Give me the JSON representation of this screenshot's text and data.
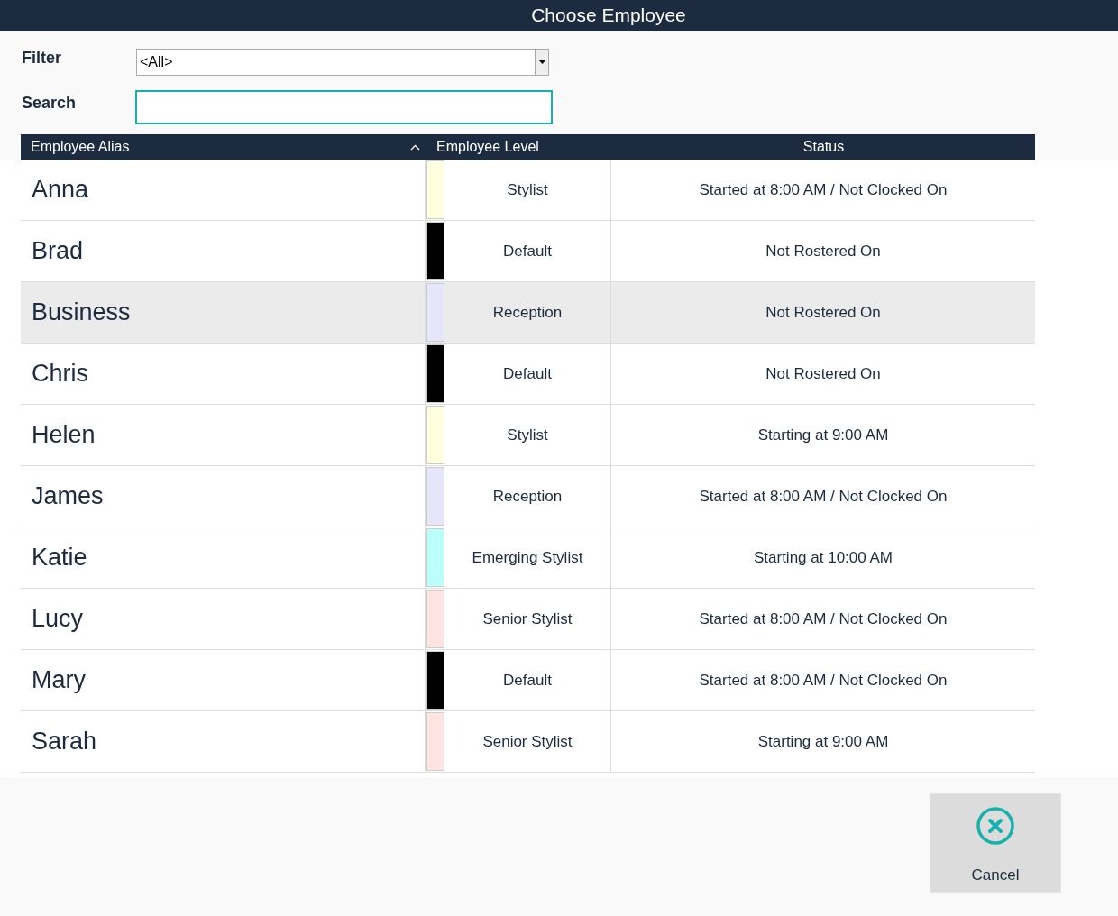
{
  "window": {
    "title": "Choose Employee"
  },
  "filter": {
    "label": "Filter",
    "value": "<All>"
  },
  "search": {
    "label": "Search"
  },
  "table": {
    "columns": [
      {
        "label": "Employee Alias",
        "sorted": true
      },
      {
        "label": "Employee Level",
        "sorted": false
      },
      {
        "label": "Status",
        "sorted": false
      }
    ],
    "rows": [
      {
        "alias": "Anna",
        "level_name": "Stylist",
        "color": "#ffffe0",
        "status": "Started at 8:00 AM / Not Clocked On",
        "selected": false
      },
      {
        "alias": "Brad",
        "level_name": "Default",
        "color": "#000000",
        "status": "Not Rostered On",
        "selected": false
      },
      {
        "alias": "Business",
        "level_name": "Reception",
        "color": "#e6e6fa",
        "status": "Not Rostered On",
        "selected": true
      },
      {
        "alias": "Chris",
        "level_name": "Default",
        "color": "#000000",
        "status": "Not Rostered On",
        "selected": false
      },
      {
        "alias": "Helen",
        "level_name": "Stylist",
        "color": "#ffffe0",
        "status": "Starting at 9:00 AM",
        "selected": false
      },
      {
        "alias": "James",
        "level_name": "Reception",
        "color": "#e6e6fa",
        "status": "Started at 8:00 AM / Not Clocked On",
        "selected": false
      },
      {
        "alias": "Katie",
        "level_name": "Emerging Stylist",
        "color": "#bbfffb",
        "status": "Starting at 10:00 AM",
        "selected": false
      },
      {
        "alias": "Lucy",
        "level_name": "Senior Stylist",
        "color": "#ffe4e1",
        "status": "Started at 8:00 AM / Not Clocked On",
        "selected": false
      },
      {
        "alias": "Mary",
        "level_name": "Default",
        "color": "#000000",
        "status": "Started at 8:00 AM / Not Clocked On",
        "selected": false
      },
      {
        "alias": "Sarah",
        "level_name": "Senior Stylist",
        "color": "#ffe4e1",
        "status": "Starting at 9:00 AM",
        "selected": false
      }
    ]
  },
  "buttons": [
    {
      "label": "Cancel",
      "kind": "cancel"
    }
  ]
}
